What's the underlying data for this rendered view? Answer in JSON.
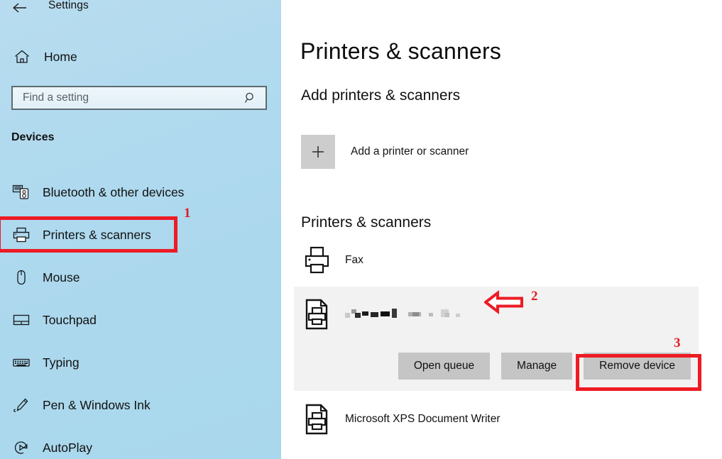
{
  "window": {
    "title": "Settings",
    "back_icon": "back-arrow-icon"
  },
  "sidebar": {
    "home": {
      "label": "Home",
      "icon": "home-icon"
    },
    "search": {
      "placeholder": "Find a setting",
      "value": "",
      "icon": "search-icon"
    },
    "section_heading": "Devices",
    "items": [
      {
        "label": "Bluetooth & other devices",
        "icon": "bluetooth-devices-icon",
        "selected": false
      },
      {
        "label": "Printers & scanners",
        "icon": "printer-icon",
        "selected": true
      },
      {
        "label": "Mouse",
        "icon": "mouse-icon",
        "selected": false
      },
      {
        "label": "Touchpad",
        "icon": "touchpad-icon",
        "selected": false
      },
      {
        "label": "Typing",
        "icon": "keyboard-icon",
        "selected": false
      },
      {
        "label": "Pen & Windows Ink",
        "icon": "pen-icon",
        "selected": false
      },
      {
        "label": "AutoPlay",
        "icon": "autoplay-icon",
        "selected": false
      }
    ]
  },
  "main": {
    "page_title": "Printers & scanners",
    "add_section": {
      "heading": "Add printers & scanners",
      "button_label": "Add a printer or scanner",
      "plus_icon": "plus-icon"
    },
    "list_section": {
      "heading": "Printers & scanners",
      "printers": [
        {
          "name": "Fax",
          "icon": "fax-printer-icon"
        },
        {
          "name": "",
          "icon": "document-printer-icon",
          "redacted": true
        },
        {
          "name": "Microsoft XPS Document Writer",
          "icon": "document-printer-icon"
        }
      ]
    },
    "selected_device": {
      "name_redacted": true,
      "buttons": [
        {
          "label": "Open queue"
        },
        {
          "label": "Manage"
        },
        {
          "label": "Remove device"
        }
      ]
    }
  },
  "annotations": [
    {
      "number": "1",
      "target": "sidebar-item-printers-scanners",
      "type": "box"
    },
    {
      "number": "2",
      "target": "selected-printer-row",
      "type": "arrow"
    },
    {
      "number": "3",
      "target": "remove-device-button",
      "type": "box"
    }
  ],
  "colors": {
    "sidebar_bg": "#aed9ee",
    "annotation_red": "#ee1b24",
    "selected_panel_bg": "#f2f2f2",
    "button_bg": "#c5c5c5"
  }
}
